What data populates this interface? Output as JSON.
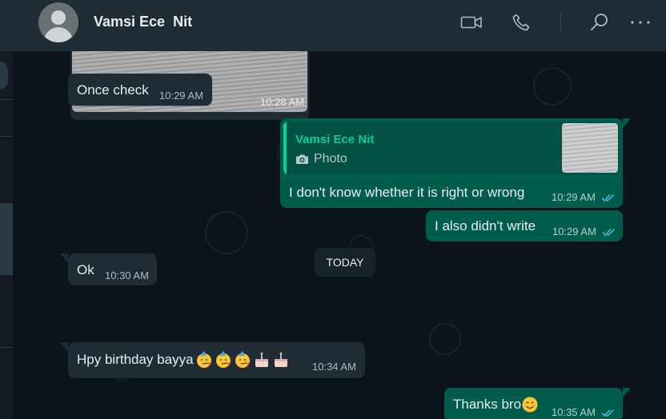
{
  "header": {
    "contact_name": "Vamsi Ece  Nit",
    "icons": [
      "video-call-icon",
      "voice-call-icon",
      "search-icon",
      "more-options-icon"
    ]
  },
  "colors": {
    "header_bg": "#202c33",
    "chat_bg": "#0b141a",
    "incoming_bubble": "#202c33",
    "outgoing_bubble": "#005c4b",
    "read_tick": "#53bdeb",
    "quote_accent": "#06cf9c"
  },
  "messages": [
    {
      "direction": "in",
      "type": "image",
      "time": "10:28 AM"
    },
    {
      "direction": "in",
      "text": "Once check",
      "time": "10:29 AM"
    },
    {
      "direction": "out",
      "reply_to": {
        "author": "Vamsi Ece Nit",
        "type_label": "Photo"
      },
      "text": "I don't know whether it is right or wrong",
      "time": "10:29 AM",
      "status": "read"
    },
    {
      "direction": "out",
      "text": "I also didn't write",
      "time": "10:29 AM",
      "status": "read"
    },
    {
      "direction": "in",
      "text": "Ok",
      "time": "10:30 AM"
    },
    {
      "direction": "in",
      "text": "Hpy birthday bayya",
      "emojis": [
        "party-face-emoji",
        "party-face-emoji",
        "party-face-emoji",
        "birthday-cake-emoji",
        "birthday-cake-emoji"
      ],
      "time": "10:34 AM"
    },
    {
      "direction": "out",
      "text": "Thanks bro",
      "emojis": [
        "smiling-face-emoji"
      ],
      "time": "10:35 AM",
      "status": "read"
    }
  ],
  "date_separator": "TODAY"
}
